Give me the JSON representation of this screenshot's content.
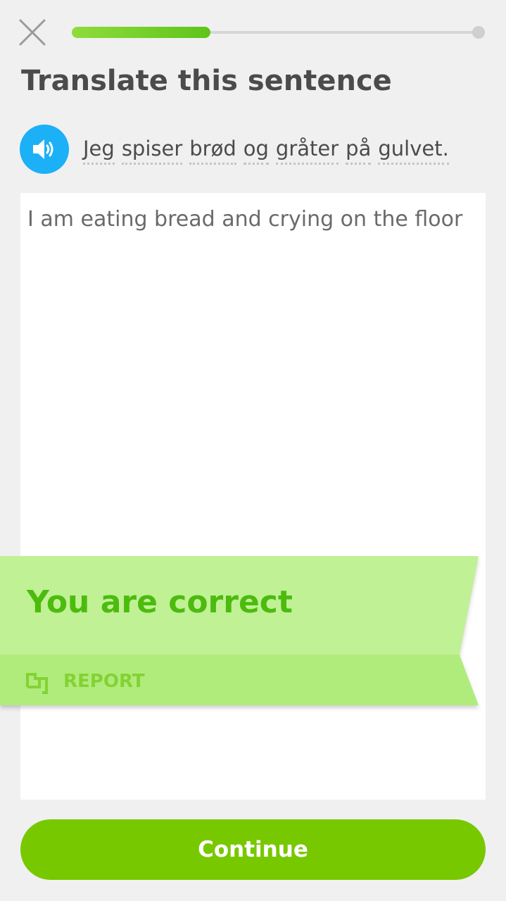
{
  "header": {
    "close_icon": "close-icon",
    "progress": 0.34
  },
  "title": "Translate this sentence",
  "prompt": {
    "speaker_icon": "speaker-icon",
    "words": [
      "Jeg",
      "spiser",
      "brød",
      "og",
      "gråter",
      "på",
      "gulvet."
    ]
  },
  "answer": {
    "value": "I am eating bread and crying on the floor"
  },
  "feedback": {
    "message": "You are correct",
    "report_icon": "flag-icon",
    "report_label": "REPORT"
  },
  "continue_label": "Continue",
  "colors": {
    "accent": "#78c800",
    "progress": "#5ec41a",
    "speaker": "#1cb0f6",
    "banner": "#c0f195",
    "success_text": "#4cbb0e"
  }
}
